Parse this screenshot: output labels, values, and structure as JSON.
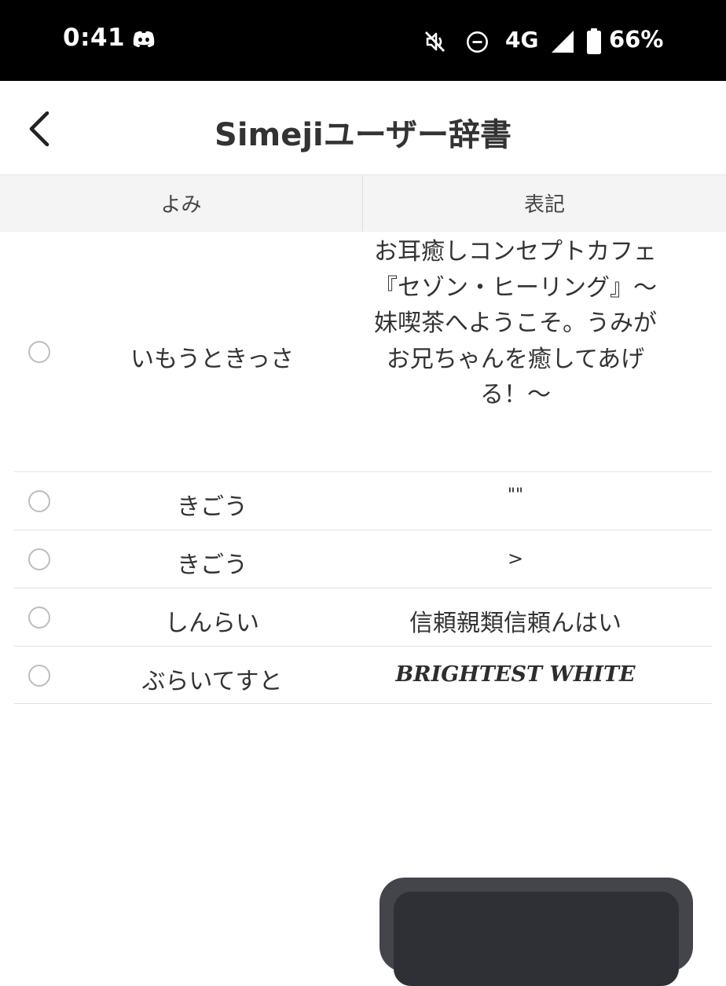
{
  "status_bar": {
    "time": "0:41",
    "network": "4G",
    "battery": "66%",
    "icons": [
      "discord-icon",
      "vibrate-off-icon",
      "do-not-disturb-icon",
      "signal-icon",
      "battery-icon"
    ]
  },
  "header": {
    "title": "Simejiユーザー辞書",
    "back_icon": "chevron-left-icon"
  },
  "table": {
    "columns": [
      "よみ",
      "表記"
    ],
    "rows": [
      {
        "yomi": "いもうときっさ",
        "hyouki_lines": [
          "お耳癒しコンセプトカフェ",
          "『セゾン・ヒーリング』〜",
          "妹喫茶へようこそ。うみが",
          "お兄ちゃんを癒してあげ",
          "る！〜"
        ],
        "selected": false
      },
      {
        "yomi": "きごう",
        "hyouki": "\"\"",
        "selected": false
      },
      {
        "yomi": "きごう",
        "hyouki": ">",
        "selected": false
      },
      {
        "yomi": "しんらい",
        "hyouki": "信頼親類信頼んはい",
        "selected": false
      },
      {
        "yomi": "ぶらいてすと",
        "hyouki": "BRIGHTEST WHITE",
        "selected": false
      }
    ]
  },
  "colors": {
    "status_bar_bg": "#000000",
    "header_bg": "#ffffff",
    "table_header_bg": "#f4f4f4",
    "text": "#333333",
    "floating_panel": "#43454b"
  }
}
